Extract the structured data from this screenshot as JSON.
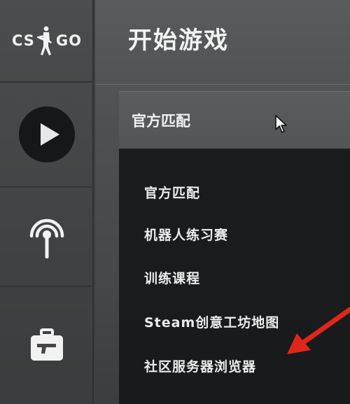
{
  "sidebar": {
    "logo_left": "CS",
    "logo_right": "GO",
    "items": [
      {
        "icon": "play-icon"
      },
      {
        "icon": "broadcast-antenna-icon"
      },
      {
        "icon": "briefcase-icon"
      }
    ]
  },
  "header": {
    "title": "开始游戏"
  },
  "mode_select": {
    "selected": "官方匹配",
    "options": [
      "官方匹配",
      "机器人练习赛",
      "训练课程",
      "Steam创意工坊地图",
      "社区服务器浏览器"
    ]
  },
  "colors": {
    "sidebar": "#434546",
    "main_bg": "#4e5051",
    "dropdown_bg": "#171819",
    "text": "#f0f0f0",
    "annotation_arrow": "#e0261a"
  }
}
